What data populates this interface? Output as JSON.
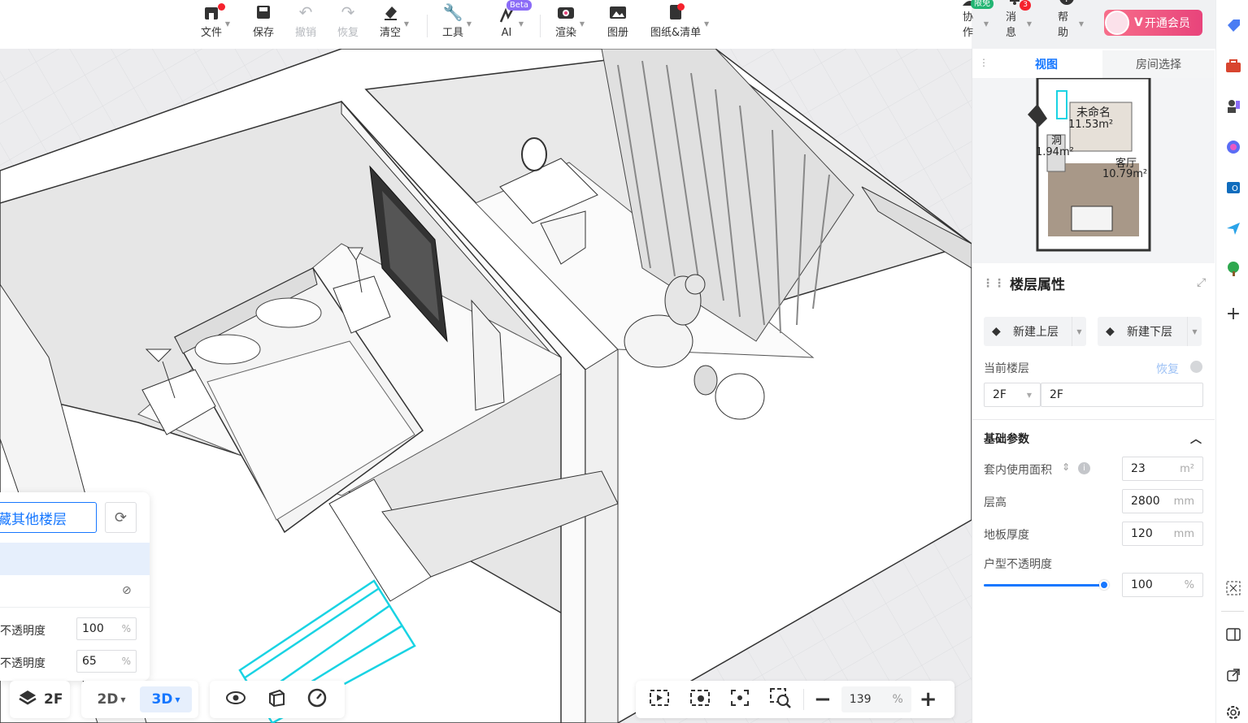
{
  "toolbar": {
    "file": "文件",
    "save": "保存",
    "undo": "撤销",
    "redo": "恢复",
    "clear": "清空",
    "tools": "工具",
    "ai": "AI",
    "ai_badge": "Beta",
    "render": "渲染",
    "album": "图册",
    "drawings": "图纸&清单",
    "collab": "协作",
    "collab_badge": "限免",
    "messages": "消息",
    "messages_count": "3",
    "help": "帮助",
    "vip": "开通会员"
  },
  "panel": {
    "tabs": [
      "视图",
      "房间选择"
    ],
    "minimap": {
      "room1_name": "未命名",
      "room1_area": "11.53m²",
      "room2_name": "洞",
      "room2_area": "1.94m²",
      "room3_name": "客厅",
      "room3_area": "10.79m²"
    },
    "floor_props_title": "楼层属性",
    "new_upper": "新建上层",
    "new_lower": "新建下层",
    "current_floor_label": "当前楼层",
    "restore": "恢复",
    "floor_select": "2F",
    "floor_name": "2F",
    "basic_params": "基础参数",
    "inner_area_label": "套内使用面积",
    "inner_area_value": "23",
    "inner_area_unit": "m²",
    "height_label": "层高",
    "height_value": "2800",
    "height_unit": "mm",
    "slab_label": "地板厚度",
    "slab_value": "120",
    "slab_unit": "mm",
    "opacity_label": "户型不透明度",
    "opacity_value": "100",
    "opacity_unit": "%",
    "opacity_fraction": 1.0
  },
  "floor_panel": {
    "input_text": "藏其他楼层",
    "opacity1_label": "不透明度",
    "opacity1_value": "100",
    "opacity1_unit": "%",
    "opacity2_label": "不透明度",
    "opacity2_value": "65",
    "opacity2_unit": "%"
  },
  "bottom": {
    "floor": "2F",
    "mode_2d": "2D",
    "mode_3d": "3D",
    "zoom": "139",
    "zoom_unit": "%"
  },
  "colors": {
    "accent": "#1677ff",
    "vip": "#e8447b",
    "selection": "#19d3e3"
  }
}
